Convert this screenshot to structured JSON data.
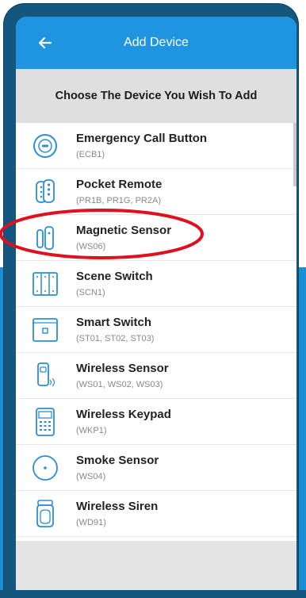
{
  "header": {
    "title": "Add Device",
    "back_icon": "back-arrow-icon"
  },
  "subheader": {
    "text": "Choose The Device You Wish To Add"
  },
  "devices": [
    {
      "name": "Emergency Call Button",
      "model": "(ECB1)",
      "icon": "emergency-button-icon"
    },
    {
      "name": "Pocket Remote",
      "model": "(PR1B, PR1G, PR2A)",
      "icon": "pocket-remote-icon"
    },
    {
      "name": "Magnetic Sensor",
      "model": "(WS06)",
      "icon": "magnetic-sensor-icon"
    },
    {
      "name": "Scene Switch",
      "model": "(SCN1)",
      "icon": "scene-switch-icon"
    },
    {
      "name": "Smart Switch",
      "model": "(ST01, ST02, ST03)",
      "icon": "smart-switch-icon"
    },
    {
      "name": "Wireless Sensor",
      "model": "(WS01, WS02, WS03)",
      "icon": "wireless-sensor-icon"
    },
    {
      "name": "Wireless Keypad",
      "model": "(WKP1)",
      "icon": "keypad-icon"
    },
    {
      "name": "Smoke Sensor",
      "model": "(WS04)",
      "icon": "smoke-sensor-icon"
    },
    {
      "name": "Wireless Siren",
      "model": "(WD91)",
      "icon": "siren-icon"
    }
  ],
  "colors": {
    "header": "#1f94e0",
    "icon_blue": "#2a8ed6",
    "highlight_ring": "#e0101e",
    "frame": "#15567f"
  }
}
